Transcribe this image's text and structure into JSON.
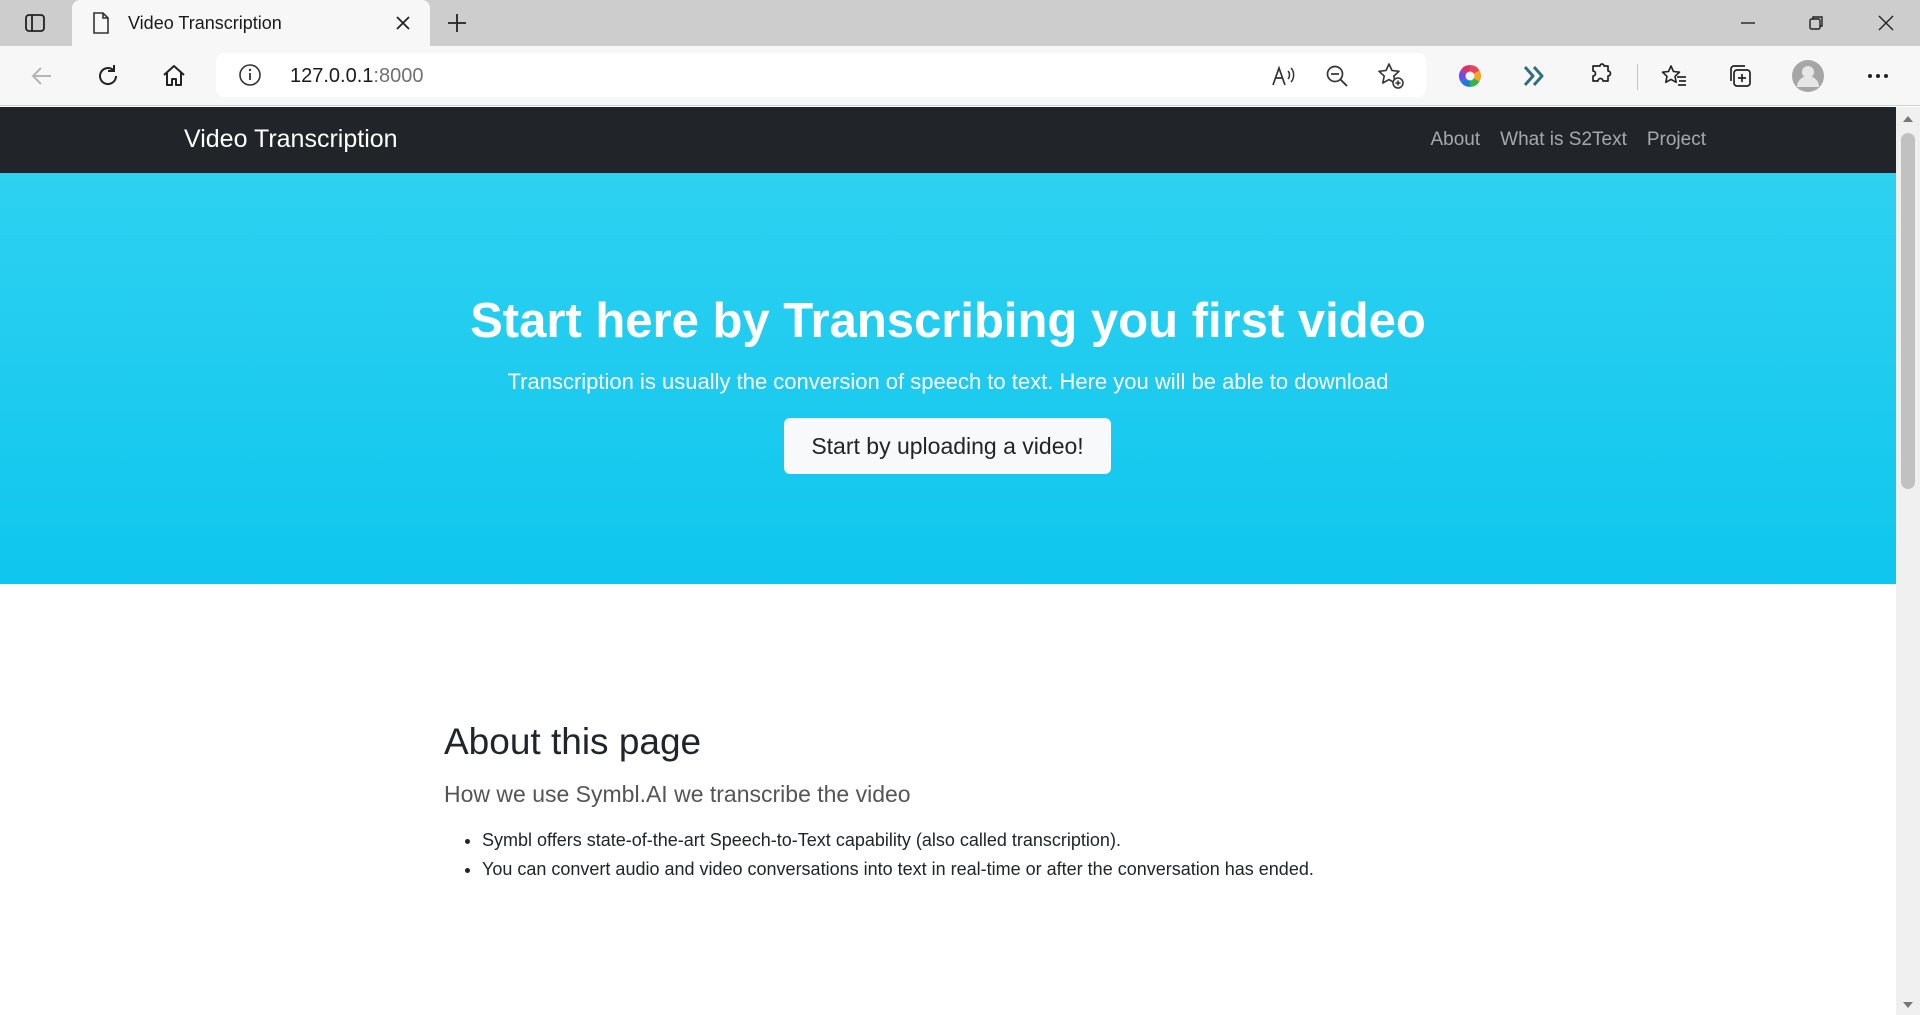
{
  "browser": {
    "tab_title": "Video Transcription",
    "url_host": "127.0.0.1",
    "url_port": ":8000",
    "icons": [
      "tab-actions-icon",
      "page-icon",
      "close-icon",
      "new-tab-icon",
      "minimize-icon",
      "restore-icon",
      "window-close-icon",
      "back-icon",
      "refresh-icon",
      "home-icon",
      "info-icon",
      "read-aloud-icon",
      "zoom-out-icon",
      "add-favorite-icon",
      "copilot-icon",
      "forward-extension-icon",
      "extensions-icon",
      "favorites-icon",
      "collections-icon",
      "profile-icon",
      "more-icon"
    ]
  },
  "navbar": {
    "brand": "Video Transcription",
    "links": [
      "About",
      "What is S2Text",
      "Project"
    ]
  },
  "hero": {
    "title": "Start here by Transcribing you first video",
    "subtitle": "Transcription is usually the conversion of speech to text. Here you will be able to download",
    "button": "Start by uploading a video!"
  },
  "about": {
    "heading": "About this page",
    "lead": "How we use Symbl.AI we transcribe the video",
    "items": [
      "Symbl offers state-of-the-art Speech-to-Text capability (also called transcription).",
      "You can convert audio and video conversations into text in real-time or after the conversation has ended."
    ]
  },
  "colors": {
    "navbar": "#212529",
    "hero": "#0dcaf0",
    "button": "#f8f9fa"
  }
}
